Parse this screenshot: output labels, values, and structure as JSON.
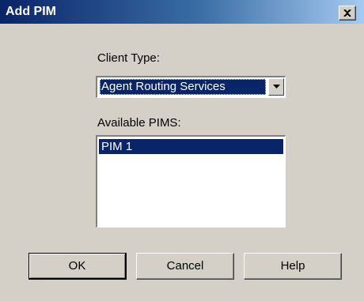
{
  "window": {
    "title": "Add PIM",
    "close_icon": "close-icon"
  },
  "client_type": {
    "label": "Client Type:",
    "selected_value": "Agent Routing Services",
    "arrow_icon": "chevron-down-icon"
  },
  "available_pims": {
    "label": "Available PIMS:",
    "items": [
      {
        "label": "PIM 1",
        "selected": true
      }
    ]
  },
  "buttons": {
    "ok_label": "OK",
    "cancel_label": "Cancel",
    "help_label": "Help"
  },
  "colors": {
    "titlebar_start": "#0a246a",
    "titlebar_end": "#a6caf0",
    "dialog_background": "#d4d0c8",
    "selection_background": "#0a246a",
    "selection_text": "#ffffff"
  }
}
